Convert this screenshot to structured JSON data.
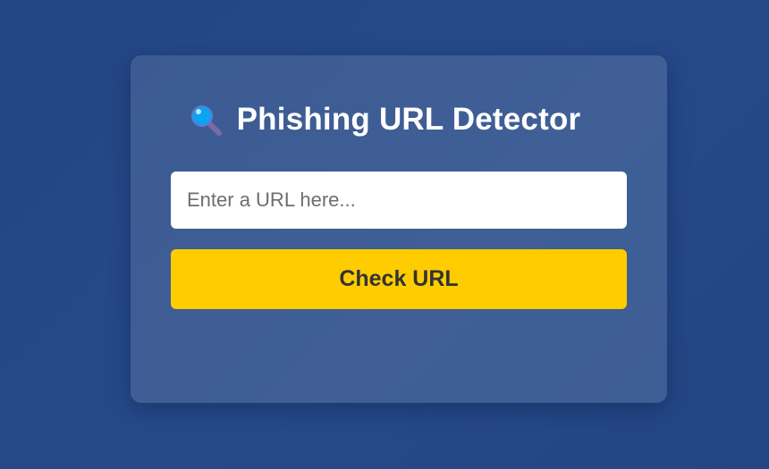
{
  "header": {
    "icon": "magnifying-glass-icon",
    "title": "Phishing URL Detector"
  },
  "form": {
    "url_input": {
      "value": "",
      "placeholder": "Enter a URL here..."
    },
    "submit_label": "Check URL"
  },
  "colors": {
    "page_background": "#234583",
    "card_background": "#3c5b93",
    "title_text": "#ffffff",
    "button_background": "#ffcc00",
    "button_text": "#333333",
    "icon_lens": "#0aa4f2",
    "icon_handle": "#7a6aa8"
  }
}
